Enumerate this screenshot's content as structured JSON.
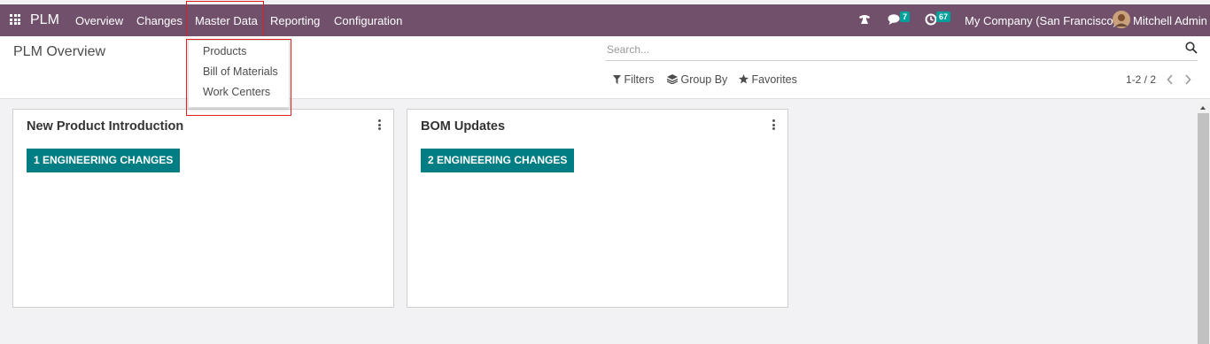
{
  "app": {
    "name": "PLM"
  },
  "nav": {
    "items": [
      "Overview",
      "Changes",
      "Master Data",
      "Reporting",
      "Configuration"
    ]
  },
  "systray": {
    "messages_count": "7",
    "activities_count": "67",
    "company": "My Company (San Francisco)",
    "user": "Mitchell Admin"
  },
  "dropdown": {
    "items": [
      "Products",
      "Bill of Materials",
      "Work Centers"
    ]
  },
  "control_panel": {
    "breadcrumb": "PLM Overview",
    "search_placeholder": "Search...",
    "filters_label": "Filters",
    "group_by_label": "Group By",
    "favorites_label": "Favorites",
    "pager": "1-2 / 2"
  },
  "cards": [
    {
      "title": "New Product Introduction",
      "button": "1 ENGINEERING CHANGES"
    },
    {
      "title": "BOM Updates",
      "button": "2 ENGINEERING CHANGES"
    }
  ],
  "colors": {
    "navbar": "#71506b",
    "accent": "#017e84",
    "highlight": "#e02020"
  }
}
